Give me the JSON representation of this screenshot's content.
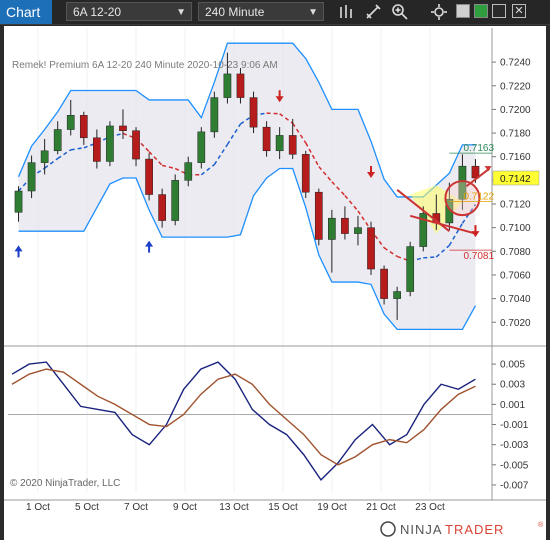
{
  "toolbar": {
    "title": "Chart",
    "instrument": "6A 12-20",
    "interval": "240 Minute",
    "icons": [
      "bar-chart-icon",
      "drawing-pencil-icon",
      "zoom-in-icon",
      "properties-icon"
    ]
  },
  "window_buttons": [
    "minimize",
    "maximize",
    "close"
  ],
  "colors": {
    "band_line": "#1e90ff",
    "band_fill": "#e4e4ec",
    "up_candle": "#2e7d32",
    "down_candle": "#b71c1c",
    "midline_up": "#1e5fd0",
    "midline_down": "#d32f2f",
    "osc_fast": "#1a237e",
    "osc_slow": "#a0522d",
    "highlight": "#ffff66",
    "circle": "#cc3333",
    "brand_accent": "#d94436"
  },
  "header_text": "Remek!  Premium  6A 12-20  240 Minute  2020-10-23 9:06 AM",
  "copyright": "© 2020 NinjaTrader, LLC",
  "brand": {
    "part1": "NINJA",
    "part2": "TRADER",
    "reg": "®"
  },
  "current_price_label": "0.7142",
  "chart_data": [
    {
      "type": "candlestick",
      "y_ticks": [
        "0.7240",
        "0.7220",
        "0.7200",
        "0.7180",
        "0.7160",
        "0.7140",
        "0.7120",
        "0.7100",
        "0.7080",
        "0.7060",
        "0.7040",
        "0.7020"
      ],
      "ylim": [
        0.7005,
        0.7257
      ],
      "x_ticks": [
        "1 Oct",
        "5 Oct",
        "7 Oct",
        "9 Oct",
        "13 Oct",
        "15 Oct",
        "19 Oct",
        "21 Oct",
        "23 Oct"
      ],
      "current_price": 0.7142,
      "levels": [
        {
          "label": "0.7163",
          "value": 0.7163
        },
        {
          "label": "0.7122",
          "value": 0.7122
        },
        {
          "label": "0.7081",
          "value": 0.7081
        }
      ],
      "candles": [
        [
          0.7113,
          0.7135,
          0.7105,
          0.7131
        ],
        [
          0.7131,
          0.7161,
          0.7125,
          0.7155
        ],
        [
          0.7155,
          0.7175,
          0.7145,
          0.7165
        ],
        [
          0.7165,
          0.719,
          0.7162,
          0.7183
        ],
        [
          0.7183,
          0.7208,
          0.7178,
          0.7195
        ],
        [
          0.7195,
          0.7198,
          0.717,
          0.7176
        ],
        [
          0.7176,
          0.7183,
          0.715,
          0.7156
        ],
        [
          0.7156,
          0.719,
          0.7152,
          0.7186
        ],
        [
          0.7186,
          0.72,
          0.7175,
          0.7182
        ],
        [
          0.7182,
          0.7185,
          0.7152,
          0.7158
        ],
        [
          0.7158,
          0.7163,
          0.7123,
          0.7128
        ],
        [
          0.7128,
          0.7133,
          0.71,
          0.7106
        ],
        [
          0.7106,
          0.7145,
          0.7102,
          0.714
        ],
        [
          0.714,
          0.716,
          0.7135,
          0.7155
        ],
        [
          0.7155,
          0.7185,
          0.715,
          0.7181
        ],
        [
          0.7181,
          0.7215,
          0.7176,
          0.721
        ],
        [
          0.721,
          0.7248,
          0.7205,
          0.723
        ],
        [
          0.723,
          0.7235,
          0.7205,
          0.721
        ],
        [
          0.721,
          0.7215,
          0.718,
          0.7185
        ],
        [
          0.7185,
          0.719,
          0.716,
          0.7165
        ],
        [
          0.7165,
          0.7185,
          0.7158,
          0.7178
        ],
        [
          0.7178,
          0.7192,
          0.7158,
          0.7162
        ],
        [
          0.7162,
          0.7165,
          0.7125,
          0.713
        ],
        [
          0.713,
          0.7133,
          0.7085,
          0.709
        ],
        [
          0.709,
          0.7115,
          0.7062,
          0.7108
        ],
        [
          0.7108,
          0.7118,
          0.709,
          0.7095
        ],
        [
          0.7095,
          0.711,
          0.7085,
          0.71
        ],
        [
          0.71,
          0.7105,
          0.706,
          0.7065
        ],
        [
          0.7065,
          0.7068,
          0.7035,
          0.704
        ],
        [
          0.704,
          0.705,
          0.7022,
          0.7046
        ],
        [
          0.7046,
          0.7088,
          0.7042,
          0.7084
        ],
        [
          0.7084,
          0.7118,
          0.708,
          0.7112
        ],
        [
          0.7112,
          0.7128,
          0.7098,
          0.7104
        ],
        [
          0.7104,
          0.7138,
          0.7098,
          0.7124
        ],
        [
          0.7124,
          0.7162,
          0.7115,
          0.7152
        ],
        [
          0.7152,
          0.7158,
          0.7138,
          0.7142
        ]
      ]
    },
    {
      "type": "line",
      "y_ticks": [
        "0.005",
        "0.003",
        "0.001",
        "-0.001",
        "-0.003",
        "-0.005",
        "-0.007"
      ],
      "ylim": [
        -0.0077,
        0.0064
      ],
      "zero_line": 0.0,
      "series": [
        {
          "values": [
            0.004,
            0.005,
            0.0052,
            0.003,
            0.0008,
            0.0005,
            0.0002,
            -0.002,
            -0.003,
            -0.001,
            0.0025,
            0.0045,
            0.0052,
            0.0035,
            0.0005,
            -0.001,
            -0.002,
            -0.004,
            -0.0065,
            -0.0048,
            -0.0025,
            -0.001,
            -0.003,
            -0.002,
            0.001,
            0.003,
            0.0025,
            0.0035
          ]
        },
        {
          "values": [
            0.003,
            0.004,
            0.0045,
            0.0042,
            0.003,
            0.0018,
            0.001,
            0.0,
            -0.001,
            -0.0012,
            0.0,
            0.002,
            0.0035,
            0.004,
            0.003,
            0.001,
            -0.0005,
            -0.002,
            -0.004,
            -0.005,
            -0.0042,
            -0.003,
            -0.0025,
            -0.0028,
            -0.0015,
            0.0005,
            0.002,
            0.0028
          ]
        }
      ]
    }
  ]
}
